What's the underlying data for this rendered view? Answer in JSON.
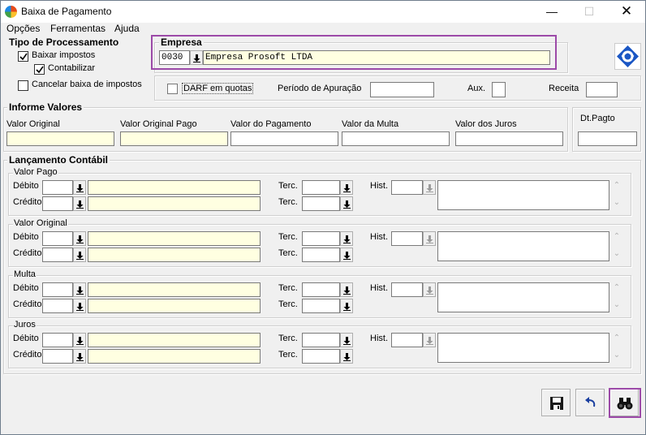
{
  "window": {
    "title": "Baixa de Pagamento"
  },
  "menu": [
    "Opções",
    "Ferramentas",
    "Ajuda"
  ],
  "tipo": {
    "title": "Tipo de Processamento",
    "baixar": "Baixar impostos",
    "contabilizar": "Contabilizar",
    "cancelar": "Cancelar baixa de impostos"
  },
  "empresa": {
    "title": "Empresa",
    "code": "0030",
    "name": "Empresa Prosoft LTDA"
  },
  "darf": {
    "quotas_label": "DARF em quotas",
    "periodo_label": "Período de Apuração",
    "aux_label": "Aux.",
    "receita_label": "Receita"
  },
  "valores": {
    "title": "Informe Valores",
    "labels": [
      "Valor Original",
      "Valor Original Pago",
      "Valor do Pagamento",
      "Valor da Multa",
      "Valor dos Juros"
    ]
  },
  "dtpagto": "Dt.Pagto",
  "lancamento": {
    "title": "Lançamento Contábil",
    "groups": [
      "Valor Pago",
      "Valor Original",
      "Multa",
      "Juros"
    ],
    "debito": "Débito",
    "credito": "Crédito",
    "terc": "Terc.",
    "hist": "Hist."
  }
}
